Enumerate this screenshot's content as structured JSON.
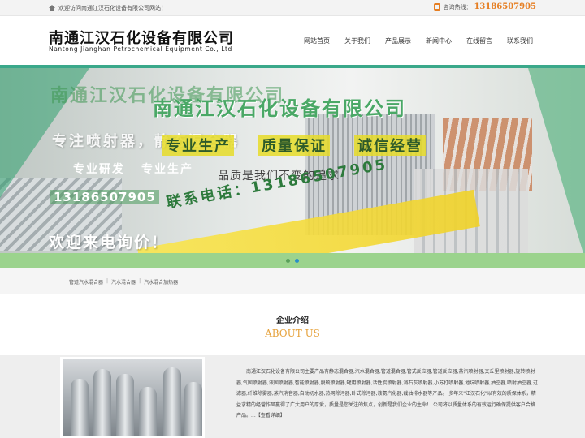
{
  "topbar": {
    "welcome": "欢迎访问南通江汉石化设备有限公司网站！",
    "hotline_label": "咨询热线：",
    "hotline_number": "13186507905"
  },
  "header": {
    "logo_cn": "南通江汉石化设备有限公司",
    "logo_en": "Nantong Jianghan Petrochemical Equipment Co., Ltd"
  },
  "nav": [
    "网站首页",
    "关于我们",
    "产品展示",
    "新闻中心",
    "在线留言",
    "联系我们"
  ],
  "banner": {
    "title_faded": "南通江汉石化设备有限公司",
    "title": "南通江汉石化设备有限公司",
    "tagline": "专注喷射器，静态混合器",
    "slogans": [
      "专业生产",
      "质量保证",
      "诚信经营"
    ],
    "sub_slogans": [
      "专业研发",
      "专业生产"
    ],
    "quality": "品质是我们不变的追求",
    "phone_box": "13186507905",
    "contact": "联系电话：13186507905",
    "cta": "欢迎来电询价！",
    "slide_count": 2,
    "active_slide": 2
  },
  "keywords": [
    "管道汽水混合器",
    "汽水混合器",
    "汽水混合加热器"
  ],
  "about": {
    "title": "企业介绍",
    "title_en": "ABOUT US",
    "body": "南通江汉石化设备有限公司主要产品有静态混合器,汽水混合器,管道混合器,管式反应器,管道反应器,蒸汽喷射器,文丘里喷射器,旋转喷射器,气固喷射器,液固喷射器,智能喷射器,脱硫喷射器,罐用喷射器,活性炭喷射器,消石灰喷射器,小苏打喷射器,地坑喷射器,抽空器,喷射抽空器,过滤器,纤维除雾器,蒸汽消音器,自动切水器,热网除污器,卧式除污器,液氨汽化器,截油排水器等产品。 多年来\"江汉石化\"以有效的质保体系，精益求精的经营作风赢得了广大用户的厚爱，质量是您关注的焦点，创新是我们企业的生命！ 公司将以质量体系的有效运行确保提供客户合格产品。",
    "more": "...【查看详细】"
  }
}
